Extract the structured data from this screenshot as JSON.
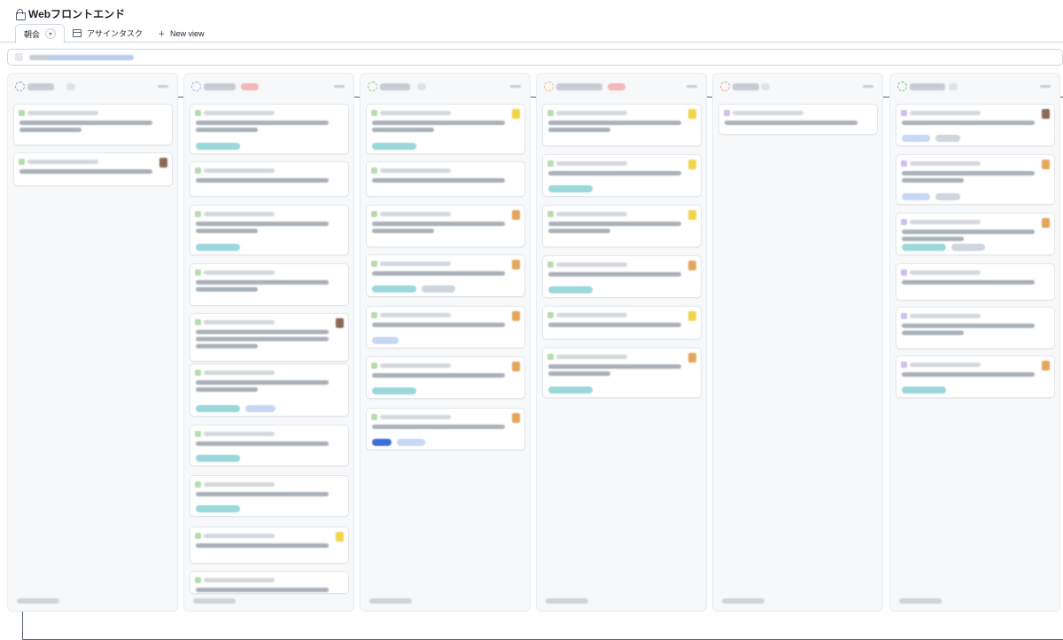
{
  "header": {
    "title": "Webフロントエンド",
    "tabs": [
      {
        "label": "朝会",
        "icon": "board-icon",
        "active": true
      },
      {
        "label": "アサインタスク",
        "icon": "table-icon",
        "active": false
      }
    ],
    "new_view_label": "New view"
  },
  "filter": {
    "icon": "filter-icon"
  },
  "colors": {
    "label_teal": "#9ad8dc",
    "label_blue": "#c6d8f4",
    "label_gray": "#cfd6dd",
    "label_darkblue": "#3f6fd8",
    "avatar_brown": "#8a6a55",
    "avatar_yellow": "#f1d548",
    "avatar_orange": "#e3a65c",
    "icon_green": "#b6dcae",
    "icon_purple": "#cdbff0"
  },
  "columns": [
    {
      "icon": "status-icon",
      "icon_color": "#8aa8e0",
      "card_count": 2
    },
    {
      "icon": "status-icon",
      "icon_color": "#9fb9e8",
      "card_count": 10
    },
    {
      "icon": "status-icon",
      "icon_color": "#9cc99a",
      "card_count": 7
    },
    {
      "icon": "status-icon",
      "icon_color": "#f0c07a",
      "card_count": 6
    },
    {
      "icon": "status-icon",
      "icon_color": "#f0a890",
      "card_count": 1
    },
    {
      "icon": "status-icon",
      "icon_color": "#79c77a",
      "card_count": 6
    }
  ]
}
